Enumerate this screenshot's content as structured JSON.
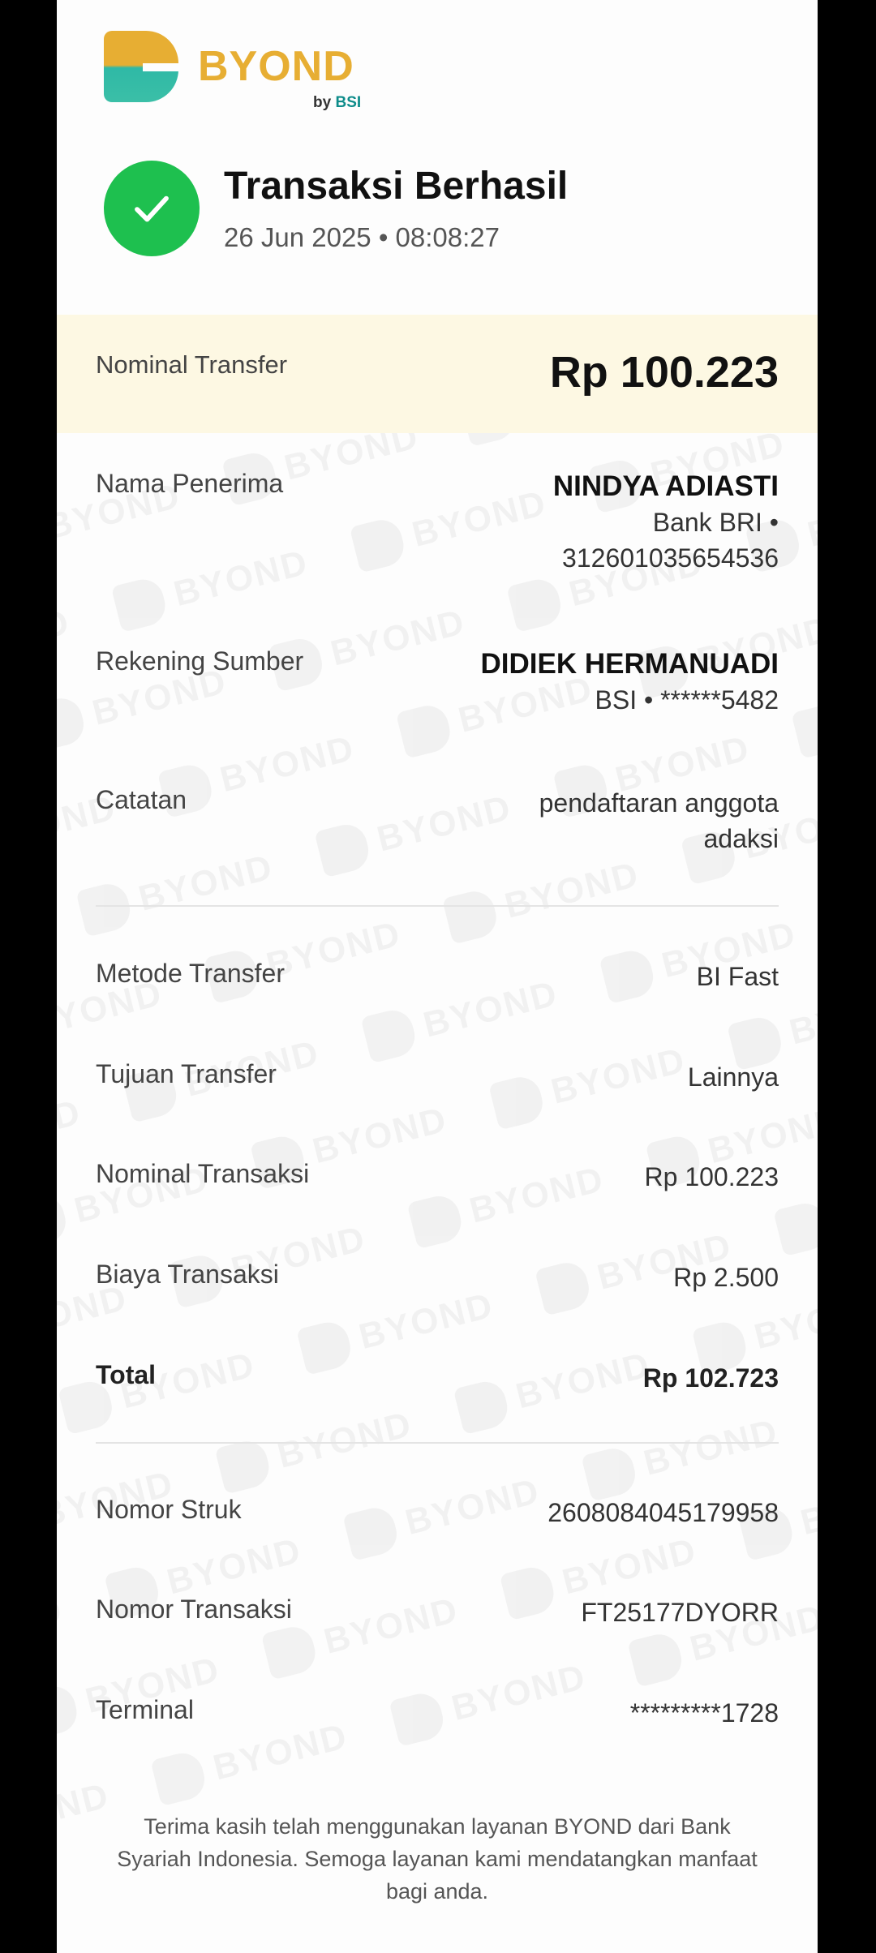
{
  "brand": {
    "name": "BYOND",
    "by_prefix": "by",
    "by_bank": "BSI"
  },
  "status": {
    "title": "Transaksi Berhasil",
    "datetime": "26 Jun 2025 • 08:08:27"
  },
  "nominal": {
    "label": "Nominal Transfer",
    "value": "Rp 100.223"
  },
  "recipient": {
    "label": "Nama Penerima",
    "name": "NINDYA ADIASTI",
    "bank": "Bank BRI •",
    "account": "312601035654536"
  },
  "source": {
    "label": "Rekening Sumber",
    "name": "DIDIEK HERMANUADI",
    "account": "BSI • ******5482"
  },
  "note": {
    "label": "Catatan",
    "line1": "pendaftaran anggota",
    "line2": "adaksi"
  },
  "details": {
    "method": {
      "label": "Metode Transfer",
      "value": "BI Fast"
    },
    "purpose": {
      "label": "Tujuan Transfer",
      "value": "Lainnya"
    },
    "amount": {
      "label": "Nominal Transaksi",
      "value": "Rp 100.223"
    },
    "fee": {
      "label": "Biaya Transaksi",
      "value": "Rp 2.500"
    },
    "total": {
      "label": "Total",
      "value": "Rp 102.723"
    }
  },
  "references": {
    "receipt": {
      "label": "Nomor Struk",
      "value": "2608084045179958"
    },
    "transaction": {
      "label": "Nomor Transaksi",
      "value": "FT25177DYORR"
    },
    "terminal": {
      "label": "Terminal",
      "value": "*********1728"
    }
  },
  "footer": "Terima kasih telah menggunakan layanan BYOND dari Bank Syariah Indonesia. Semoga layanan kami mendatangkan manfaat bagi anda.",
  "colors": {
    "accent_gold": "#e7ae33",
    "accent_teal": "#2fb9a6",
    "success_green": "#1ec04f",
    "highlight_band": "#fdf8e3"
  },
  "icons": {
    "success": "check-circle-icon"
  }
}
